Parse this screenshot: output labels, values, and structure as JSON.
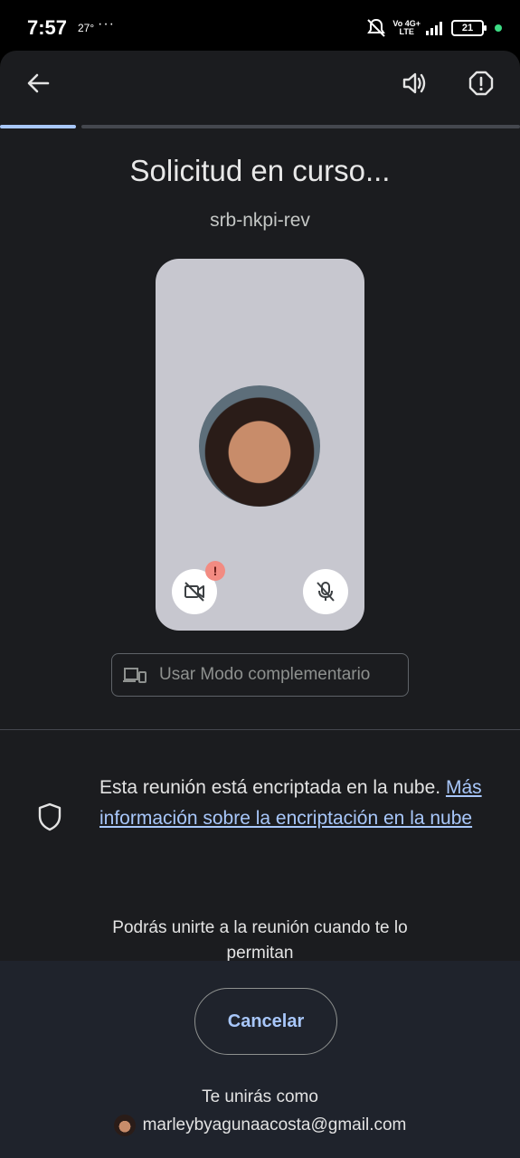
{
  "status_bar": {
    "time": "7:57",
    "temperature": "27°",
    "more": "···",
    "network_top": "Vo 4G+",
    "network_bottom": "LTE",
    "battery": "21"
  },
  "toolbar": {
    "back_icon": "arrow-left-icon",
    "speaker_icon": "volume-icon",
    "report_icon": "report-icon"
  },
  "progress": {
    "value": 0.15
  },
  "main": {
    "title": "Solicitud en curso...",
    "meeting_code": "srb-nkpi-rev",
    "companion_mode_label": "Usar Modo complementario"
  },
  "encryption": {
    "text": "Esta reunión está encriptada en la nube.",
    "link": "Más información sobre la encriptación en la nube"
  },
  "waiting_text": "Podrás unirte a la reunión cuando te lo permitan",
  "footer": {
    "cancel_label": "Cancelar",
    "join_as_label": "Te unirás como",
    "email": "marleybyagunaacosta@gmail.com"
  },
  "colors": {
    "background": "#1b1c1f",
    "accent": "#a8c7fa",
    "bottom_sheet": "#1f232c"
  }
}
